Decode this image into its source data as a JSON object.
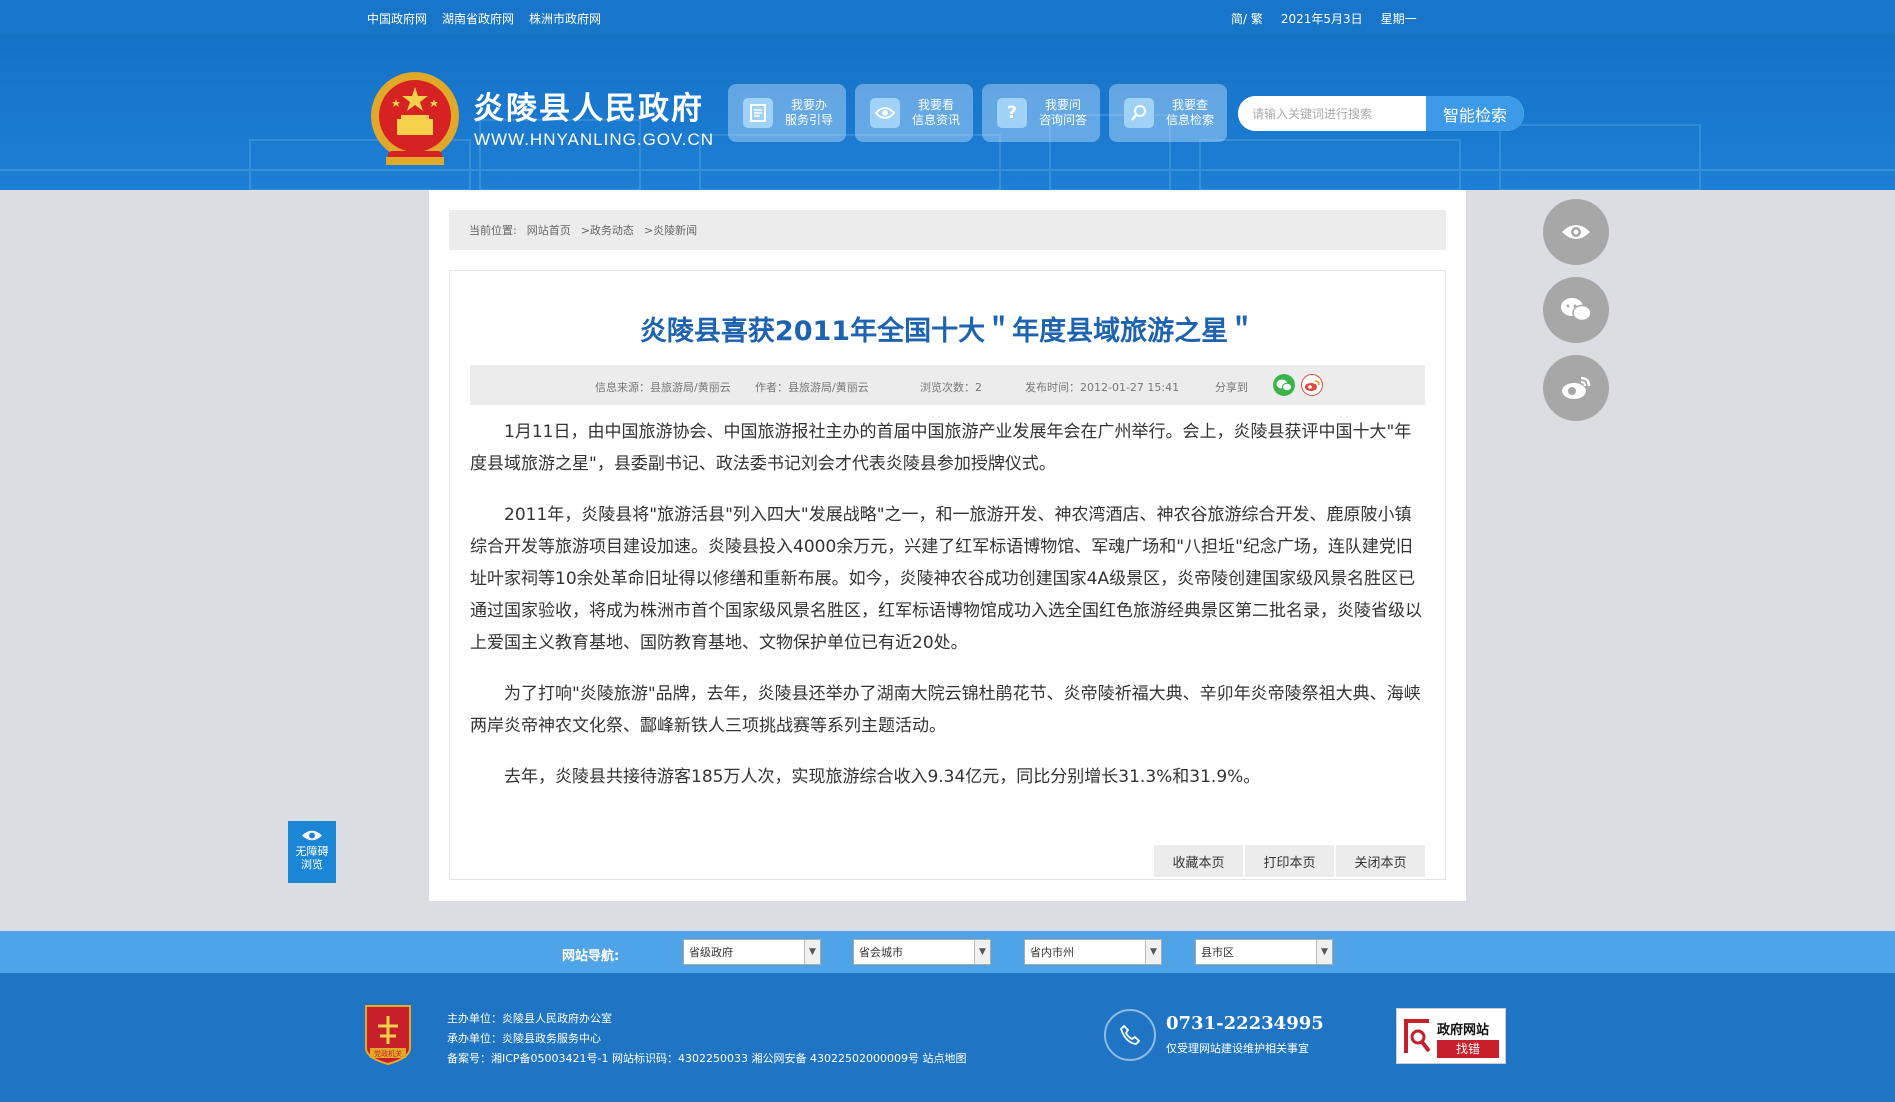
{
  "topbar": {
    "links": [
      "中国政府网",
      "湖南省政府网",
      "株洲市政府网"
    ],
    "lang": "简/ 繁",
    "date": "2021年5月3日",
    "weekday": "星期一"
  },
  "header": {
    "title": "炎陵县人民政府",
    "url": "WWW.HNYANLING.GOV.CN",
    "quick": [
      {
        "line1": "我要办",
        "line2": "服务引导",
        "icon": "document-icon"
      },
      {
        "line1": "我要看",
        "line2": "信息资讯",
        "icon": "eye-icon"
      },
      {
        "line1": "我要问",
        "line2": "咨询问答",
        "icon": "question-icon"
      },
      {
        "line1": "我要查",
        "line2": "信息检索",
        "icon": "search-icon"
      }
    ],
    "search_placeholder": "请输入关键词进行搜索",
    "search_button": "智能检索"
  },
  "breadcrumb": {
    "label": "当前位置:",
    "items": [
      "网站首页",
      ">政务动态",
      ">炎陵新闻"
    ]
  },
  "article": {
    "title": "炎陵县喜获2011年全国十大＂年度县域旅游之星＂",
    "meta": {
      "source": "信息来源：县旅游局/黄丽云",
      "author": "作者：县旅游局/黄丽云",
      "views": "浏览次数：2",
      "time": "发布时间：2012-01-27 15:41",
      "share": "分享到"
    },
    "paragraphs": [
      "1月11日，由中国旅游协会、中国旅游报社主办的首届中国旅游产业发展年会在广州举行。会上，炎陵县获评中国十大\"年度县域旅游之星\"，县委副书记、政法委书记刘会才代表炎陵县参加授牌仪式。",
      "2011年，炎陵县将\"旅游活县\"列入四大\"发展战略\"之一，和一旅游开发、神农湾酒店、神农谷旅游综合开发、鹿原陂小镇综合开发等旅游项目建设加速。炎陵县投入4000余万元，兴建了红军标语博物馆、军魂广场和\"八担坵\"纪念广场，连队建党旧址叶家祠等10余处革命旧址得以修缮和重新布展。如今，炎陵神农谷成功创建国家4A级景区，炎帝陵创建国家级风景名胜区已通过国家验收，将成为株洲市首个国家级风景名胜区，红军标语博物馆成功入选全国红色旅游经典景区第二批名录，炎陵省级以上爱国主义教育基地、国防教育基地、文物保护单位已有近20处。",
      "为了打响\"炎陵旅游\"品牌，去年，炎陵县还举办了湖南大院云锦杜鹃花节、炎帝陵祈福大典、辛卯年炎帝陵祭祖大典、海峡两岸炎帝神农文化祭、酃峰新铁人三项挑战赛等系列主题活动。",
      "去年，炎陵县共接待游客185万人次，实现旅游综合收入9.34亿元，同比分别增长31.3%和31.9%。"
    ],
    "actions": [
      "收藏本页",
      "打印本页",
      "关闭本页"
    ]
  },
  "accessibility": {
    "line1": "无障碍",
    "line2": "浏览"
  },
  "nav": {
    "label": "网站导航:",
    "selects": [
      "省级政府",
      "省会城市",
      "省内市州",
      "县市区"
    ]
  },
  "footer": {
    "host": "主办单位：炎陵县人民政府办公室",
    "organizer": "承办单位：炎陵县政务服务中心",
    "record": "备案号：湘ICP备05003421号-1  网站标识码：4302250033  湘公网安备 43022502000009号  站点地图",
    "phone": "0731-22234995",
    "phone_note": "仅受理网站建设维护相关事宜",
    "badge_line1": "政府网站",
    "badge_line2": "找错",
    "emblem_text": "党政机关"
  },
  "colors": {
    "primary": "#1875c9",
    "title_blue": "#1e63b0",
    "nav_strip": "#4ea4e6"
  }
}
